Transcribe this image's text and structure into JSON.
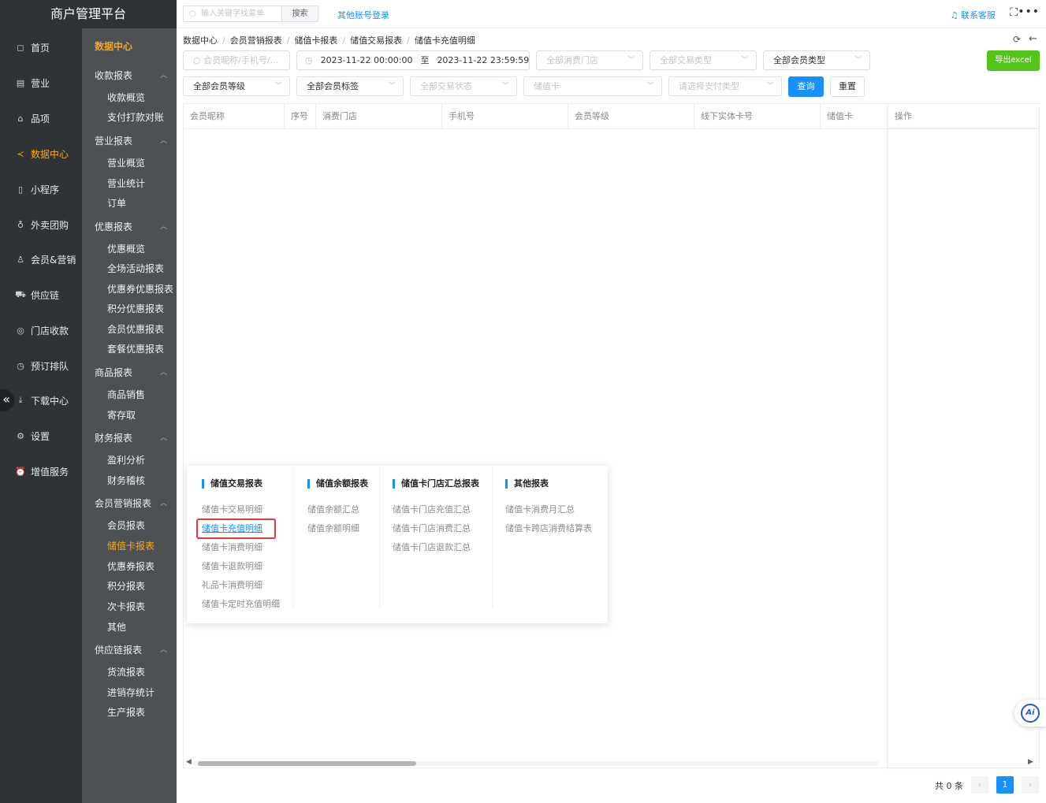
{
  "app": {
    "title": "商户管理平台"
  },
  "nav": {
    "items": [
      {
        "label": "首页",
        "icon": "◻"
      },
      {
        "label": "营业",
        "icon": "▤"
      },
      {
        "label": "品项",
        "icon": "⌂"
      },
      {
        "label": "数据中心",
        "icon": "≺",
        "active": true
      },
      {
        "label": "小程序",
        "icon": "▯"
      },
      {
        "label": "外卖团购",
        "icon": "♁"
      },
      {
        "label": "会员&营销",
        "icon": "♙"
      },
      {
        "label": "供应链",
        "icon": "⛟"
      },
      {
        "label": "门店收款",
        "icon": "◎"
      },
      {
        "label": "预订排队",
        "icon": "◷"
      },
      {
        "label": "下载中心",
        "icon": "⤓"
      },
      {
        "label": "设置",
        "icon": "⚙"
      },
      {
        "label": "增值服务",
        "icon": "⏰"
      }
    ],
    "collapse": "«"
  },
  "subnav": {
    "top": "数据中心",
    "groups": [
      {
        "label": "收款报表",
        "links": [
          "收款概览",
          "支付打款对账"
        ]
      },
      {
        "label": "营业报表",
        "links": [
          "营业概览",
          "营业统计",
          "订单"
        ]
      },
      {
        "label": "优惠报表",
        "links": [
          "优惠概览",
          "全场活动报表",
          "优惠券优惠报表",
          "积分优惠报表",
          "会员优惠报表",
          "套餐优惠报表"
        ]
      },
      {
        "label": "商品报表",
        "links": [
          "商品销售",
          "寄存取"
        ]
      },
      {
        "label": "财务报表",
        "links": [
          "盈利分析",
          "财务稽核"
        ]
      },
      {
        "label": "会员营销报表",
        "links": [
          "会员报表",
          "储值卡报表",
          "优惠券报表",
          "积分报表",
          "次卡报表",
          "其他"
        ]
      },
      {
        "label": "供应链报表",
        "links": [
          "货流报表",
          "进销存统计",
          "生产报表"
        ]
      }
    ],
    "active_link": "储值卡报表"
  },
  "topbar": {
    "search_placeholder": "输入关键字找菜单",
    "search_button": "搜索",
    "other_login": "其他账号登录",
    "contact": "联系客服"
  },
  "breadcrumb": [
    "数据中心",
    "会员营销报表",
    "储值卡报表",
    "储值交易报表",
    "储值卡充值明细"
  ],
  "filters": {
    "member_search": "会员昵称/手机号/...",
    "date_start": "2023-11-22 00:00:00",
    "date_to": "至",
    "date_end": "2023-11-22 23:59:59",
    "store": "全部消费门店",
    "trade_type": "全部交易类型",
    "member_type": "全部会员类型",
    "member_level": "全部会员等级",
    "member_tag": "全部会员标签",
    "trade_status": "全部交易状态",
    "card": "储值卡",
    "pay_type": "请选择支付类型",
    "query": "查询",
    "reset": "重置",
    "export": "导出excel"
  },
  "table": {
    "columns": [
      "会员昵称",
      "序号",
      "消费门店",
      "手机号",
      "会员等级",
      "线下实体卡号",
      "储值卡"
    ],
    "ops_column": "操作"
  },
  "popover": {
    "columns": [
      {
        "title": "储值交易报表",
        "links": [
          "储值卡交易明细",
          "储值卡充值明细",
          "储值卡消费明细",
          "储值卡退款明细",
          "礼品卡消费明细",
          "储值卡定时充值明细"
        ]
      },
      {
        "title": "储值余额报表",
        "links": [
          "储值余额汇总",
          "储值余额明细"
        ]
      },
      {
        "title": "储值卡门店汇总报表",
        "links": [
          "储值卡门店充值汇总",
          "储值卡门店消费汇总",
          "储值卡门店退款汇总"
        ]
      },
      {
        "title": "其他报表",
        "links": [
          "储值卡消费月汇总",
          "储值卡跨店消费结算表"
        ]
      }
    ],
    "selected": "储值卡充值明细"
  },
  "pagination": {
    "total": "共 0 条",
    "current": "1",
    "prev": "‹",
    "next": "›"
  },
  "ai": {
    "label": "Ai"
  },
  "colors": {
    "accent": "#1890ff",
    "active_nav": "#f5a623",
    "export": "#52c41a",
    "nav_bg": "#2f3336",
    "subnav_bg": "#4d5154"
  }
}
